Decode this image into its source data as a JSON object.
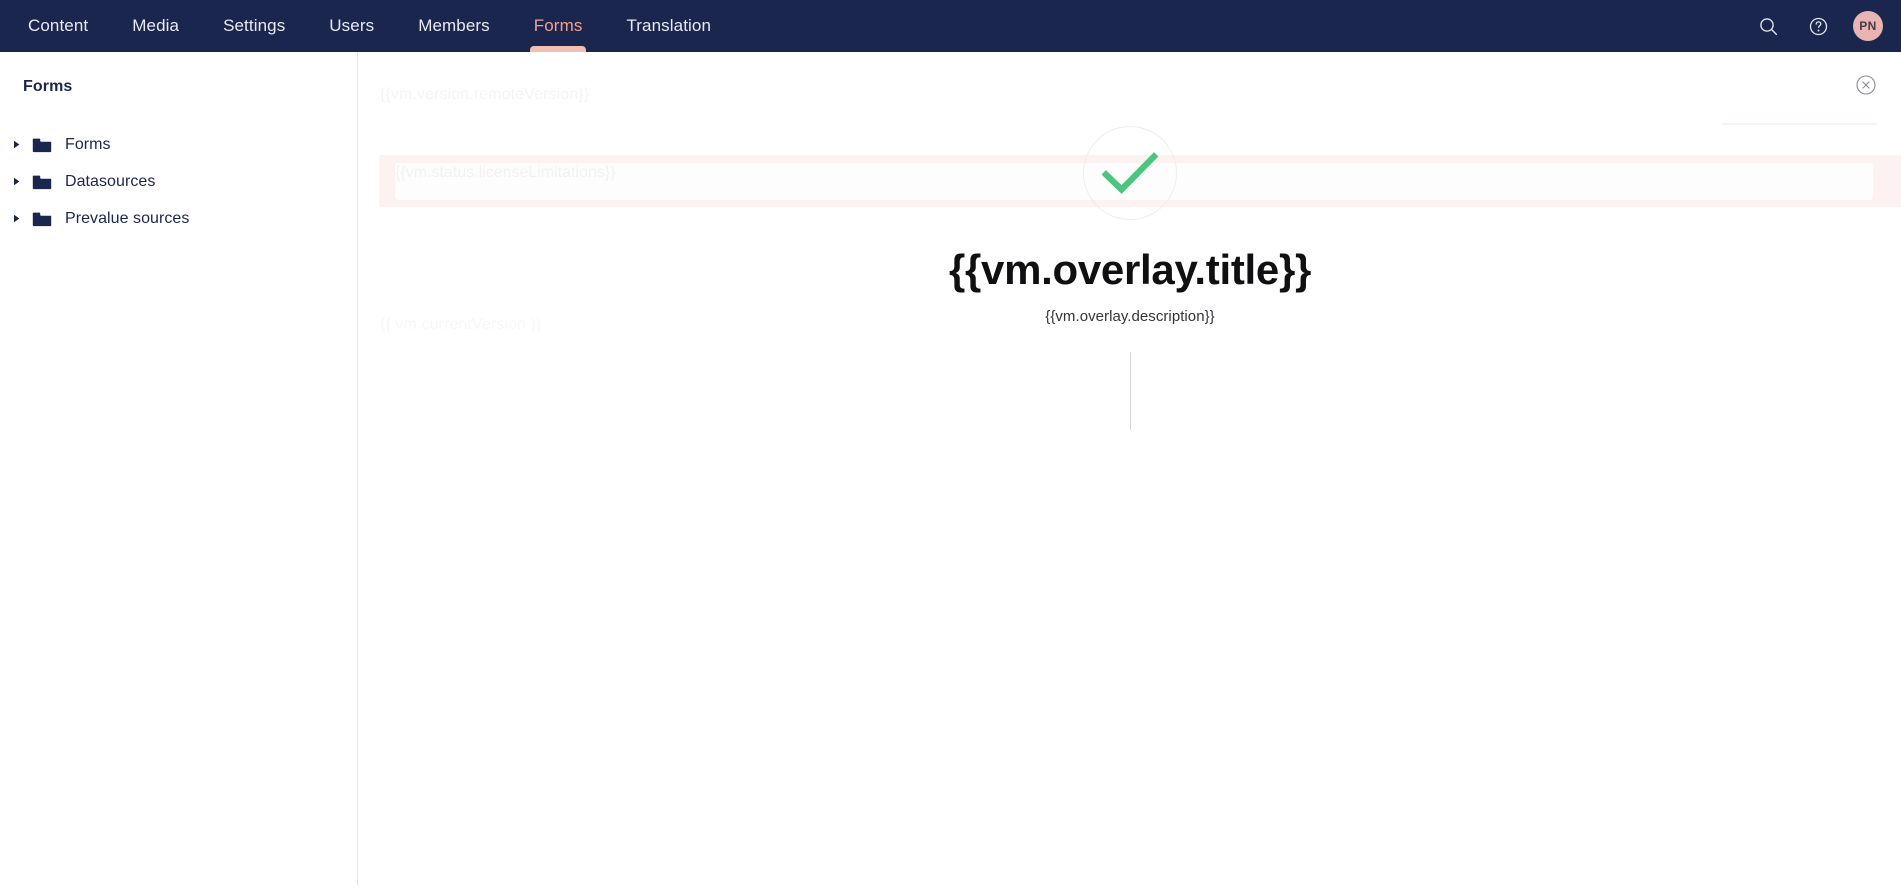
{
  "topnav": {
    "tabs": [
      {
        "label": "Content",
        "active": false
      },
      {
        "label": "Media",
        "active": false
      },
      {
        "label": "Settings",
        "active": false
      },
      {
        "label": "Users",
        "active": false
      },
      {
        "label": "Members",
        "active": false
      },
      {
        "label": "Forms",
        "active": true
      },
      {
        "label": "Translation",
        "active": false
      }
    ],
    "search_icon": "search-icon",
    "help_icon": "question-mark-icon",
    "avatar_initials": "PN",
    "background_color": "#1b264f",
    "active_tab_color": "#f0a090"
  },
  "sidebar": {
    "title": "Forms",
    "items": [
      {
        "label": "Forms",
        "icon": "folder-icon",
        "caret": "caret-right-icon",
        "expanded": false
      },
      {
        "label": "Datasources",
        "icon": "folder-icon",
        "caret": "caret-right-icon",
        "expanded": false
      },
      {
        "label": "Prevalue sources",
        "icon": "folder-icon",
        "caret": "caret-right-icon",
        "expanded": false
      }
    ]
  },
  "content": {
    "close_button_icon": "close-circle-icon",
    "background": {
      "remote_version": "{{vm.version.remoteVersion}}",
      "current_version": "{{ vm.currentVersion }}",
      "license_limitations": "{{vm.status.licenseLimitations}}",
      "banner_color": "#fdf1f2"
    }
  },
  "overlay": {
    "icon": "check-mark-icon",
    "icon_color": "#4cc57f",
    "title": "{{vm.overlay.title}}",
    "description": "{{vm.overlay.description}}"
  }
}
